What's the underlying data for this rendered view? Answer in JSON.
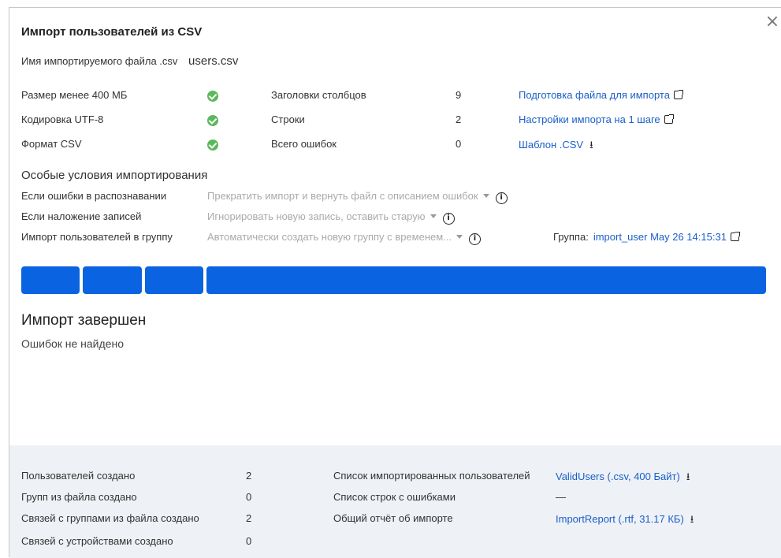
{
  "dialog": {
    "title": "Импорт пользователей из CSV",
    "close_glyph": "×",
    "file_label": "Имя импортируемого файла .csv",
    "file_name": "users.csv"
  },
  "checks": [
    {
      "label": "Размер менее 400 МБ",
      "stat_label": "Заголовки столбцов",
      "stat_value": "9",
      "link": "Подготовка файла для импорта",
      "link_icon": "external-link-icon"
    },
    {
      "label": "Кодировка UTF-8",
      "stat_label": "Строки",
      "stat_value": "2",
      "link": "Настройки импорта на 1 шаге",
      "link_icon": "external-link-icon"
    },
    {
      "label": "Формат CSV",
      "stat_label": "Всего ошибок",
      "stat_value": "0",
      "link": "Шаблон .CSV",
      "link_icon": "download-icon"
    }
  ],
  "options": {
    "title": "Особые условия импортирования",
    "rows": [
      {
        "label": "Если ошибки в распознавании",
        "value": "Прекратить импорт и вернуть файл с описанием ошибок"
      },
      {
        "label": "Если наложение записей",
        "value": "Игнорировать новую запись, оставить старую"
      },
      {
        "label": "Импорт пользователей в группу",
        "value": "Автоматически создать новую группу с временем..."
      }
    ],
    "group_label": "Группа:",
    "group_value": "import_user May 26 14:15:31"
  },
  "progress": {
    "segments": 4,
    "color": "#0a63e0",
    "complete": 1.0
  },
  "result": {
    "title": "Импорт завершен",
    "subtitle": "Ошибок не найдено"
  },
  "footer": {
    "rows": [
      {
        "label": "Пользователей создано",
        "value": "2",
        "label2": "Список импортированных пользователей",
        "value2": "ValidUsers (.csv, 400 Байт)",
        "value2_link": true
      },
      {
        "label": "Групп из файла создано",
        "value": "0",
        "label2": "Список строк с ошибками",
        "value2": "—",
        "value2_link": false
      },
      {
        "label": "Связей с группами из файла создано",
        "value": "2",
        "label2": "Общий отчёт об импорте",
        "value2": "ImportReport (.rtf, 31.17 КБ)",
        "value2_link": true
      },
      {
        "label": "Связей с устройствами создано",
        "value": "0",
        "label2": "",
        "value2": "",
        "value2_link": false
      }
    ]
  },
  "colors": {
    "link": "#1a5fc9",
    "accent": "#0a63e0",
    "success": "#5cb85c",
    "footer_bg": "#eef1f6"
  }
}
